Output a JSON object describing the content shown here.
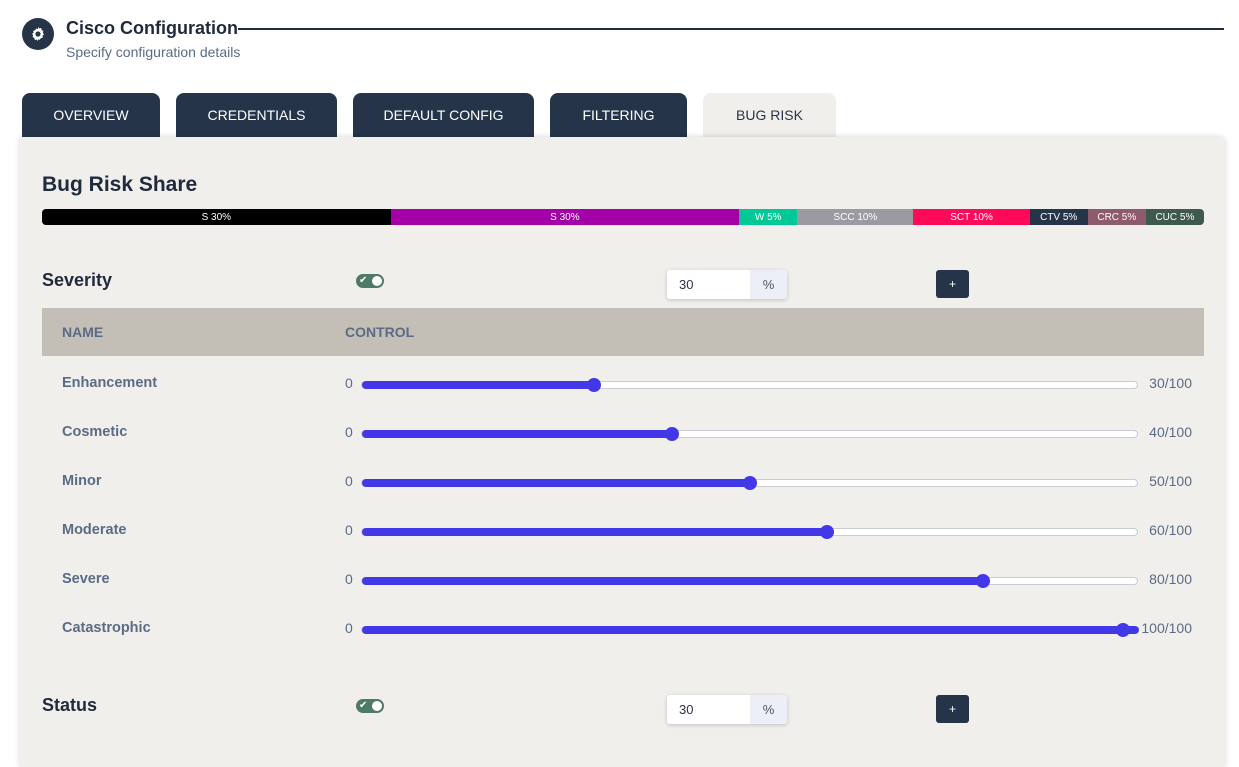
{
  "header": {
    "title": "Cisco Configuration",
    "subtitle": "Specify configuration details",
    "icon": "gear-icon"
  },
  "tabs": [
    {
      "label": "OVERVIEW",
      "active": false
    },
    {
      "label": "CREDENTIALS",
      "active": false
    },
    {
      "label": "DEFAULT CONFIG",
      "active": false
    },
    {
      "label": "FILTERING",
      "active": false
    },
    {
      "label": "BUG RISK",
      "active": true
    }
  ],
  "share": {
    "title": "Bug Risk Share",
    "segments": [
      {
        "label": "S 30%",
        "percent": 30,
        "color": "#000000"
      },
      {
        "label": "S 30%",
        "percent": 30,
        "color": "#a300a8"
      },
      {
        "label": "W 5%",
        "percent": 5,
        "color": "#00c896"
      },
      {
        "label": "SCC 10%",
        "percent": 10,
        "color": "#9c9aa1"
      },
      {
        "label": "SCT 10%",
        "percent": 10,
        "color": "#ff0a5a"
      },
      {
        "label": "CTV 5%",
        "percent": 5,
        "color": "#26344a"
      },
      {
        "label": "CRC 5%",
        "percent": 5,
        "color": "#8e5a6e"
      },
      {
        "label": "CUC 5%",
        "percent": 5,
        "color": "#3e5a4e"
      }
    ]
  },
  "severity": {
    "label": "Severity",
    "enabled": true,
    "percent_value": "30",
    "percent_unit": "%",
    "add_label": "+",
    "columns": {
      "name": "NAME",
      "control": "CONTROL"
    },
    "rows": [
      {
        "name": "Enhancement",
        "min": "0",
        "value": 30,
        "max_label": "30/100"
      },
      {
        "name": "Cosmetic",
        "min": "0",
        "value": 40,
        "max_label": "40/100"
      },
      {
        "name": "Minor",
        "min": "0",
        "value": 50,
        "max_label": "50/100"
      },
      {
        "name": "Moderate",
        "min": "0",
        "value": 60,
        "max_label": "60/100"
      },
      {
        "name": "Severe",
        "min": "0",
        "value": 80,
        "max_label": "80/100"
      },
      {
        "name": "Catastrophic",
        "min": "0",
        "value": 100,
        "max_label": "100/100"
      }
    ]
  },
  "status": {
    "label": "Status",
    "enabled": true,
    "percent_value": "30",
    "percent_unit": "%",
    "add_label": "+"
  },
  "colors": {
    "accent": "#4338e8",
    "dark": "#26344a",
    "toggle_on": "#4f7a67"
  }
}
